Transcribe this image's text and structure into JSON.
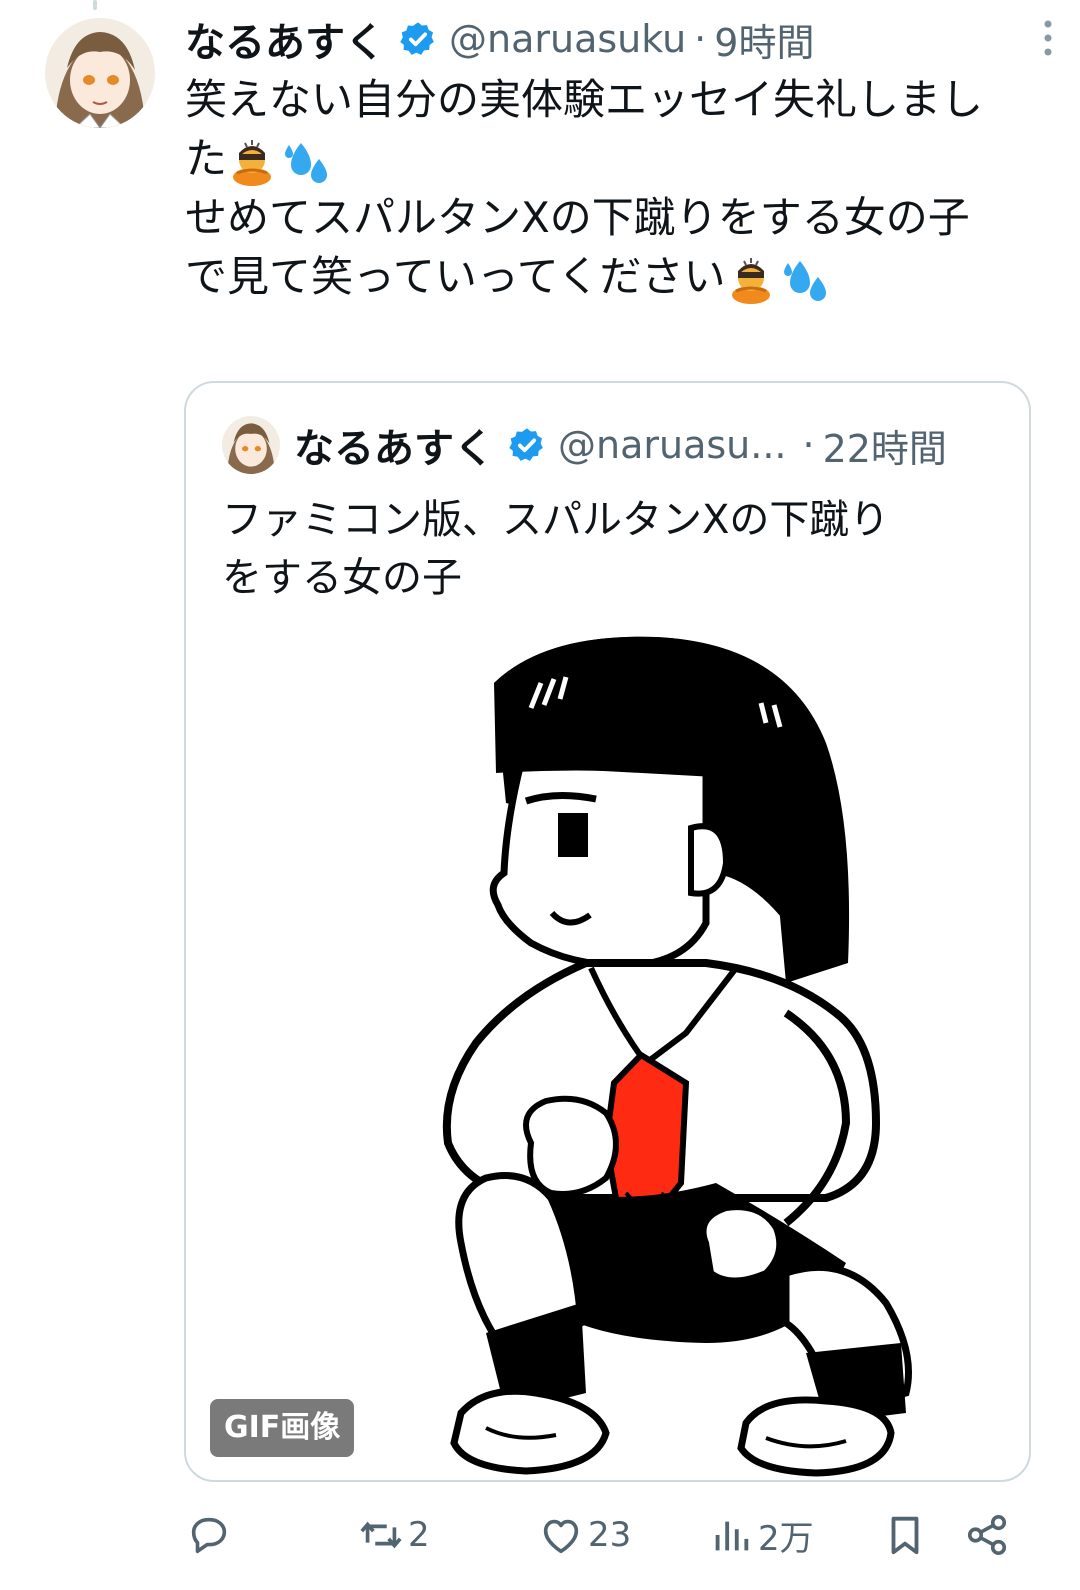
{
  "tweet": {
    "author_name": "なるあすく",
    "handle": "@naruasuku",
    "separator": "·",
    "time": "9時間",
    "text_lines": [
      "笑えない自分の実体験エッセイ失礼しまし",
      "た",
      "",
      "せめてスパルタンXの下蹴りをする女の子",
      "で見て笑っていってください"
    ]
  },
  "quote": {
    "author_name": "なるあすく",
    "handle": "@naruasu...",
    "separator": "·",
    "time": "22時間",
    "text_lines": [
      "ファミコン版、スパルタンXの下蹴り",
      "をする女の子"
    ],
    "media_badge": "GIF画像"
  },
  "actions": {
    "reply_count": "",
    "retweet_count": "2",
    "like_count": "23",
    "views_count": "2万"
  },
  "colors": {
    "verified_blue": "#1d9bf0",
    "muted_text": "#536471",
    "border": "#cfd9de",
    "tie_red": "#ff2a12"
  },
  "icons": [
    "more-vertical-icon",
    "verified-badge-icon",
    "reply-icon",
    "retweet-icon",
    "like-icon",
    "views-icon",
    "bookmark-icon",
    "share-icon"
  ]
}
